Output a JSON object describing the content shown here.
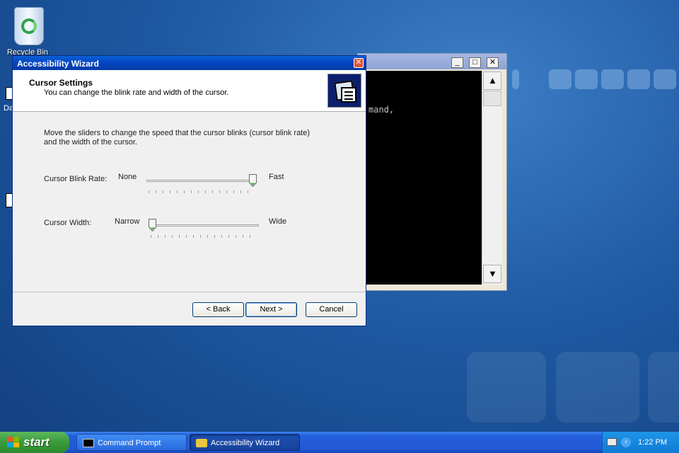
{
  "desktop": {
    "recycle_bin_label": "Recycle Bin",
    "peek_text_da": "Da"
  },
  "cmd_window": {
    "visible_text": "mand,",
    "minimize_glyph": "_",
    "maximize_glyph": "□",
    "close_glyph": "✕",
    "scroll_up_glyph": "▲",
    "scroll_down_glyph": "▼"
  },
  "wizard": {
    "title": "Accessibility Wizard",
    "close_glyph": "✕",
    "header_title": "Cursor Settings",
    "header_subtitle": "You can change the blink rate and width of the cursor.",
    "intro": "Move the sliders to change the speed that the cursor blinks (cursor blink rate) and the width of the cursor.",
    "blink": {
      "label": "Cursor Blink Rate:",
      "min_label": "None",
      "max_label": "Fast",
      "value_fraction": 1.0
    },
    "width": {
      "label": "Cursor Width:",
      "min_label": "Narrow",
      "max_label": "Wide",
      "value_fraction": 0.0
    },
    "buttons": {
      "back": "< Back",
      "next": "Next >",
      "cancel": "Cancel"
    }
  },
  "taskbar": {
    "start_label": "start",
    "tasks": [
      {
        "label": "Command Prompt",
        "active": false
      },
      {
        "label": "Accessibility Wizard",
        "active": true
      }
    ],
    "clock": "1:22 PM",
    "tray_chevron": "‹"
  },
  "colors": {
    "titlebar_active": "#0445c0",
    "start_green": "#3a9a3a",
    "taskbar_blue": "#245edb",
    "close_red": "#d8573a"
  }
}
